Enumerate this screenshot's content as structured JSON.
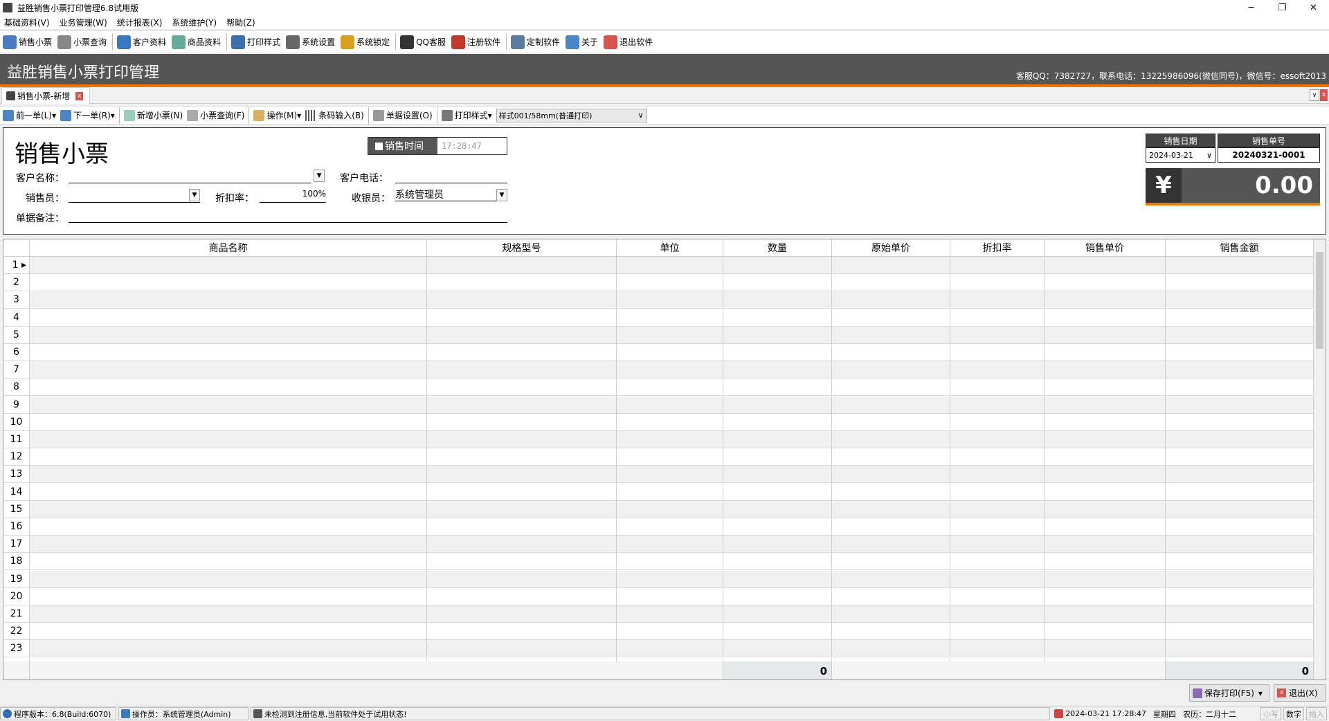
{
  "window": {
    "title": "益胜销售小票打印管理6.8试用版",
    "minimize": "─",
    "restore": "❐",
    "close": "✕"
  },
  "menu": [
    "基础资料(V)",
    "业务管理(W)",
    "统计报表(X)",
    "系统维护(Y)",
    "帮助(Z)"
  ],
  "toolbar": [
    {
      "label": "销售小票",
      "icon": "receipt-icon",
      "color": "#4a7bbf"
    },
    {
      "label": "小票查询",
      "icon": "search-document-icon",
      "color": "#888"
    },
    {
      "label": "客户资料",
      "icon": "users-icon",
      "color": "#3b78c2"
    },
    {
      "label": "商品资料",
      "icon": "table-icon",
      "color": "#6a9"
    },
    {
      "label": "打印样式",
      "icon": "print-style-icon",
      "color": "#3b6fb0"
    },
    {
      "label": "系统设置",
      "icon": "gear-icon",
      "color": "#666"
    },
    {
      "label": "系统锁定",
      "icon": "lock-icon",
      "color": "#d9a020"
    },
    {
      "label": "QQ客服",
      "icon": "qq-icon",
      "color": "#333"
    },
    {
      "label": "注册软件",
      "icon": "register-icon",
      "color": "#c0392b"
    },
    {
      "label": "定制软件",
      "icon": "window-icon",
      "color": "#5a7aa0"
    },
    {
      "label": "关于",
      "icon": "info-icon",
      "color": "#4a86c5"
    },
    {
      "label": "退出软件",
      "icon": "exit-icon",
      "color": "#d9534f"
    }
  ],
  "header": {
    "title": "益胜销售小票打印管理",
    "contact": "客服QQ：7382727，联系电话：13225986096(微信同号)，微信号：essoft2013"
  },
  "tab": {
    "label": "销售小票-新增",
    "close": "x"
  },
  "toolbar2": {
    "prev": "前一单(L)",
    "next": "下一单(R)",
    "new": "新增小票(N)",
    "query": "小票查询(F)",
    "ops": "操作(M)",
    "barcode": "条码输入(B)",
    "doc_settings": "单据设置(O)",
    "print_style": "打印样式",
    "style_value": "样式001/58mm(普通打印)"
  },
  "form": {
    "title": "销售小票",
    "sale_time_label": "销售时间",
    "sale_time": "17:28:47",
    "customer_name_label": "客户名称：",
    "customer_name": "",
    "customer_phone_label": "客户电话：",
    "customer_phone": "",
    "salesperson_label": "销售员：",
    "salesperson": "",
    "discount_label": "折扣率：",
    "discount": "100%",
    "cashier_label": "收银员：",
    "cashier": "系统管理员",
    "remark_label": "单据备注：",
    "remark": "",
    "date_label": "销售日期",
    "date": "2024-03-21",
    "number_label": "销售单号",
    "number": "20240321-0001",
    "currency": "¥",
    "total": "0.00"
  },
  "grid": {
    "columns": [
      "商品名称",
      "规格型号",
      "单位",
      "数量",
      "原始单价",
      "折扣率",
      "销售单价",
      "销售金额"
    ],
    "rows": [
      "1",
      "2",
      "3",
      "4",
      "5",
      "6",
      "7",
      "8",
      "9",
      "10",
      "11",
      "12",
      "13",
      "14",
      "15",
      "16",
      "17",
      "18",
      "19",
      "20",
      "21",
      "22",
      "23",
      ""
    ],
    "qty_total": "0",
    "amount_total": "0"
  },
  "buttons": {
    "save_print": "保存打印(F5)",
    "exit": "退出(X)"
  },
  "status": {
    "version": "程序版本：6.8(Build:6070)",
    "operator": "操作员：系统管理员(Admin)",
    "notice": "未检测到注册信息,当前软件处于试用状态!",
    "datetime": "2024-03-21 17:28:47",
    "weekday": "星期四",
    "lunar": "农历：二月十二",
    "caps": "小写",
    "num": "数字",
    "ins": "插入"
  }
}
